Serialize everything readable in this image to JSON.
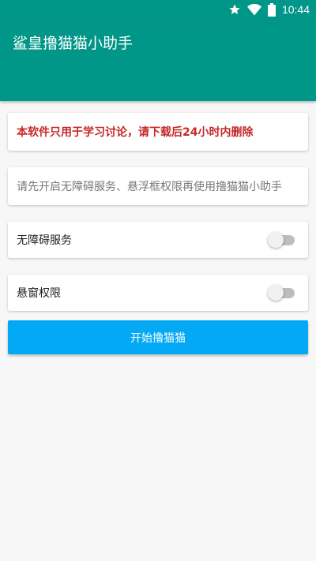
{
  "status_bar": {
    "time": "10:44",
    "icons": [
      "star-icon",
      "wifi-icon",
      "battery-icon"
    ]
  },
  "app_bar": {
    "title": "鲨皇撸猫猫小助手",
    "color": "#009688"
  },
  "notice": {
    "text": "本软件只用于学习讨论，请下载后24小时内删除",
    "color": "#c62828"
  },
  "hint": {
    "text": "请先开启无障碍服务、悬浮框权限再使用撸猫猫小助手"
  },
  "settings": [
    {
      "label": "无障碍服务",
      "enabled": false
    },
    {
      "label": "悬窗权限",
      "enabled": false
    }
  ],
  "start_button": {
    "label": "开始撸猫猫",
    "color": "#03a9f4"
  }
}
